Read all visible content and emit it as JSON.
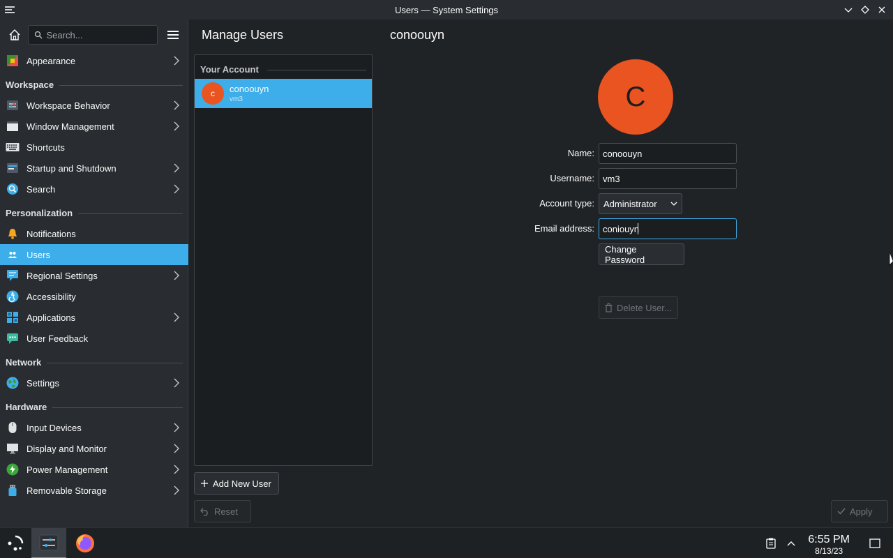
{
  "window": {
    "title": "Users — System Settings"
  },
  "sidebar": {
    "search_placeholder": "Search...",
    "items": [
      {
        "type": "item",
        "label": "Appearance",
        "icon": "appearance-icon",
        "chevron": true
      },
      {
        "type": "section",
        "label": "Workspace"
      },
      {
        "type": "item",
        "label": "Workspace Behavior",
        "icon": "workspace-behavior-icon",
        "chevron": true
      },
      {
        "type": "item",
        "label": "Window Management",
        "icon": "window-management-icon",
        "chevron": true
      },
      {
        "type": "item",
        "label": "Shortcuts",
        "icon": "keyboard-icon",
        "chevron": false
      },
      {
        "type": "item",
        "label": "Startup and Shutdown",
        "icon": "startup-icon",
        "chevron": true
      },
      {
        "type": "item",
        "label": "Search",
        "icon": "search-globe-icon",
        "chevron": true
      },
      {
        "type": "section",
        "label": "Personalization"
      },
      {
        "type": "item",
        "label": "Notifications",
        "icon": "bell-icon",
        "chevron": false
      },
      {
        "type": "item",
        "label": "Users",
        "icon": "users-icon",
        "chevron": false,
        "active": true
      },
      {
        "type": "item",
        "label": "Regional Settings",
        "icon": "regional-icon",
        "chevron": true
      },
      {
        "type": "item",
        "label": "Accessibility",
        "icon": "accessibility-icon",
        "chevron": false
      },
      {
        "type": "item",
        "label": "Applications",
        "icon": "applications-icon",
        "chevron": true
      },
      {
        "type": "item",
        "label": "User Feedback",
        "icon": "feedback-icon",
        "chevron": false
      },
      {
        "type": "section",
        "label": "Network"
      },
      {
        "type": "item",
        "label": "Settings",
        "icon": "globe-icon",
        "chevron": true
      },
      {
        "type": "section",
        "label": "Hardware"
      },
      {
        "type": "item",
        "label": "Input Devices",
        "icon": "mouse-icon",
        "chevron": true
      },
      {
        "type": "item",
        "label": "Display and Monitor",
        "icon": "monitor-icon",
        "chevron": true
      },
      {
        "type": "item",
        "label": "Power Management",
        "icon": "power-icon",
        "chevron": true
      },
      {
        "type": "item",
        "label": "Removable Storage",
        "icon": "usb-icon",
        "chevron": true
      }
    ]
  },
  "main": {
    "left_title": "Manage Users",
    "right_title": "conoouyn"
  },
  "accounts": {
    "section_label": "Your Account",
    "items": [
      {
        "initial": "c",
        "name": "conoouyn",
        "username": "vm3"
      }
    ],
    "add_button": "Add New User",
    "reset_button": "Reset"
  },
  "form": {
    "avatar_letter": "C",
    "name_label": "Name:",
    "name_value": "conoouyn",
    "username_label": "Username:",
    "username_value": "vm3",
    "account_type_label": "Account type:",
    "account_type_value": "Administrator",
    "email_label": "Email address:",
    "email_value": "coniouyn",
    "change_password_button": "Change Password",
    "delete_user_button": "Delete User..."
  },
  "apply_button": "Apply",
  "taskbar": {
    "time": "6:55 PM",
    "date": "8/13/23"
  },
  "colors": {
    "accent": "#3daee9",
    "avatar": "#e95420",
    "background": "#202326",
    "sidebar": "#292c30"
  }
}
